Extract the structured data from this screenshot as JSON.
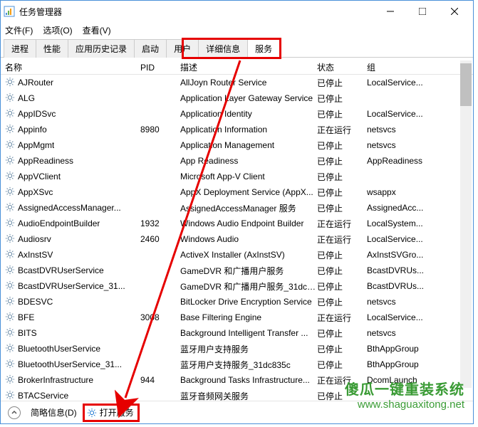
{
  "window": {
    "title": "任务管理器"
  },
  "menu": {
    "file": "文件(F)",
    "options": "选项(O)",
    "view": "查看(V)"
  },
  "tabs": [
    "进程",
    "性能",
    "应用历史记录",
    "启动",
    "用户",
    "详细信息",
    "服务"
  ],
  "active_tab": 6,
  "headers": {
    "name": "名称",
    "pid": "PID",
    "desc": "描述",
    "status": "状态",
    "group": "组"
  },
  "services": [
    {
      "name": "AJRouter",
      "pid": "",
      "desc": "AllJoyn Router Service",
      "status": "已停止",
      "group": "LocalService..."
    },
    {
      "name": "ALG",
      "pid": "",
      "desc": "Application Layer Gateway Service",
      "status": "已停止",
      "group": ""
    },
    {
      "name": "AppIDSvc",
      "pid": "",
      "desc": "Application Identity",
      "status": "已停止",
      "group": "LocalService..."
    },
    {
      "name": "Appinfo",
      "pid": "8980",
      "desc": "Application Information",
      "status": "正在运行",
      "group": "netsvcs"
    },
    {
      "name": "AppMgmt",
      "pid": "",
      "desc": "Application Management",
      "status": "已停止",
      "group": "netsvcs"
    },
    {
      "name": "AppReadiness",
      "pid": "",
      "desc": "App Readiness",
      "status": "已停止",
      "group": "AppReadiness"
    },
    {
      "name": "AppVClient",
      "pid": "",
      "desc": "Microsoft App-V Client",
      "status": "已停止",
      "group": ""
    },
    {
      "name": "AppXSvc",
      "pid": "",
      "desc": "AppX Deployment Service (AppX...",
      "status": "已停止",
      "group": "wsappx"
    },
    {
      "name": "AssignedAccessManager...",
      "pid": "",
      "desc": "AssignedAccessManager 服务",
      "status": "已停止",
      "group": "AssignedAcc..."
    },
    {
      "name": "AudioEndpointBuilder",
      "pid": "1932",
      "desc": "Windows Audio Endpoint Builder",
      "status": "正在运行",
      "group": "LocalSystem..."
    },
    {
      "name": "Audiosrv",
      "pid": "2460",
      "desc": "Windows Audio",
      "status": "正在运行",
      "group": "LocalService..."
    },
    {
      "name": "AxInstSV",
      "pid": "",
      "desc": "ActiveX Installer (AxInstSV)",
      "status": "已停止",
      "group": "AxInstSVGro..."
    },
    {
      "name": "BcastDVRUserService",
      "pid": "",
      "desc": "GameDVR 和广播用户服务",
      "status": "已停止",
      "group": "BcastDVRUs..."
    },
    {
      "name": "BcastDVRUserService_31...",
      "pid": "",
      "desc": "GameDVR 和广播用户服务_31dc8...",
      "status": "已停止",
      "group": "BcastDVRUs..."
    },
    {
      "name": "BDESVC",
      "pid": "",
      "desc": "BitLocker Drive Encryption Service",
      "status": "已停止",
      "group": "netsvcs"
    },
    {
      "name": "BFE",
      "pid": "3008",
      "desc": "Base Filtering Engine",
      "status": "正在运行",
      "group": "LocalService..."
    },
    {
      "name": "BITS",
      "pid": "",
      "desc": "Background Intelligent Transfer ...",
      "status": "已停止",
      "group": "netsvcs"
    },
    {
      "name": "BluetoothUserService",
      "pid": "",
      "desc": "蓝牙用户支持服务",
      "status": "已停止",
      "group": "BthAppGroup"
    },
    {
      "name": "BluetoothUserService_31...",
      "pid": "",
      "desc": "蓝牙用户支持服务_31dc835c",
      "status": "已停止",
      "group": "BthAppGroup"
    },
    {
      "name": "BrokerInfrastructure",
      "pid": "944",
      "desc": "Background Tasks Infrastructure...",
      "status": "正在运行",
      "group": "DcomLaunch"
    },
    {
      "name": "BTACService",
      "pid": "",
      "desc": "蓝牙音频网关服务",
      "status": "已停止",
      "group": ""
    }
  ],
  "bottom": {
    "brief": "简略信息(D)",
    "open_services": "打开服务"
  },
  "watermark": {
    "line1": "傻瓜一键重装系统",
    "line2": "www.shaguaxitong.net"
  }
}
